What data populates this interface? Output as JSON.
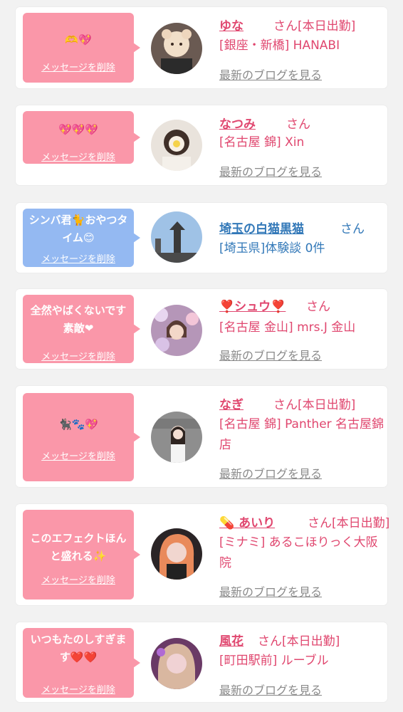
{
  "delete_label": "メッセージを削除",
  "blog_label": "最新のブログを見る",
  "colors": {
    "pink_bubble": "#fa97a9",
    "blue_bubble": "#94b9f2",
    "pink_text": "#e0476f",
    "blue_text": "#3278b8"
  },
  "items": [
    {
      "message": "🫶💖",
      "name": "ゆな",
      "honorific": "さん",
      "status": "[本日出勤]",
      "shop": "[銀座・新橋] HANABI",
      "blog": "最新のブログを見る"
    },
    {
      "message": "💖💖💖",
      "name": "なつみ",
      "honorific": "さん",
      "status": "",
      "shop": "[名古屋 錦] Xin",
      "blog": "最新のブログを見る"
    },
    {
      "message": "シンバ君🐈おやつタイム😊",
      "name": "埼玉の白猫黒猫",
      "honorific": "さん",
      "status": "",
      "shop": "[埼玉県]体験談 0件",
      "blog": ""
    },
    {
      "message": "全然やばくないです素敵❤",
      "name": "❣️シュウ❣️",
      "honorific": "さん",
      "status": "",
      "shop": "[名古屋 金山] mrs.J 金山",
      "blog": "最新のブログを見る"
    },
    {
      "message": "🐈‍⬛🐾💖",
      "name": "なぎ",
      "honorific": "さん",
      "status": "[本日出勤]",
      "shop": "[名古屋 錦] Panther 名古屋錦店",
      "blog": "最新のブログを見る"
    },
    {
      "message": "このエフェクトほんと盛れる✨",
      "name": "💊 あいり",
      "honorific": "さん",
      "status": "[本日出勤]",
      "shop": "[ミナミ] あるこほりっく大阪院",
      "blog": "最新のブログを見る"
    },
    {
      "message": "いつもたのしすぎます❤️❤️",
      "name": "風花",
      "honorific": "さん",
      "status": "[本日出勤]",
      "shop": "[町田駅前] ルーブル",
      "blog": "最新のブログを見る"
    }
  ]
}
